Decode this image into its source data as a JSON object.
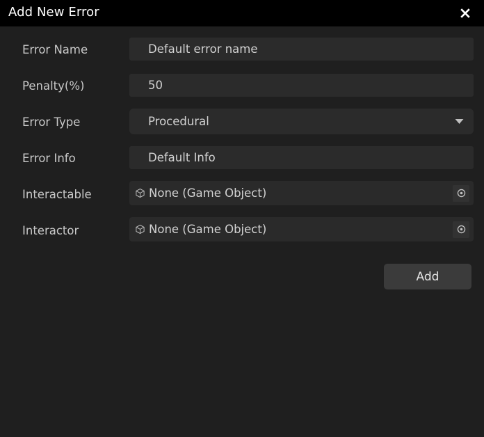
{
  "window": {
    "title": "Add New Error",
    "close_icon": "close-icon"
  },
  "form": {
    "rows": [
      {
        "label": "Error Name",
        "type": "text",
        "value": "Default error name",
        "placeholder": "Error name"
      },
      {
        "label": "Penalty(%)",
        "type": "text",
        "value": "50",
        "placeholder": "0"
      },
      {
        "label": "Error Type",
        "type": "dropdown",
        "value": "Procedural",
        "caret_icon": "chevron-down-icon",
        "options": [
          "Procedural"
        ]
      },
      {
        "label": "Error Info",
        "type": "text",
        "value": "Default Info",
        "placeholder": "Info"
      },
      {
        "label": "Interactable",
        "type": "object",
        "value": "None (Game Object)",
        "object_icon": "cube-icon",
        "picker_icon": "object-picker-icon"
      },
      {
        "label": "Interactor",
        "type": "object",
        "value": "None (Game Object)",
        "object_icon": "cube-icon",
        "picker_icon": "object-picker-icon"
      }
    ]
  },
  "actions": {
    "add_label": "Add"
  },
  "colors": {
    "titlebar_bg": "#000000",
    "body_bg": "#1f1f1f",
    "field_bg": "#2b2b2b",
    "button_bg": "#3b3b3b",
    "label_text": "#c9c9c9",
    "value_text": "#d2d2d2",
    "title_text": "#ffffff"
  }
}
